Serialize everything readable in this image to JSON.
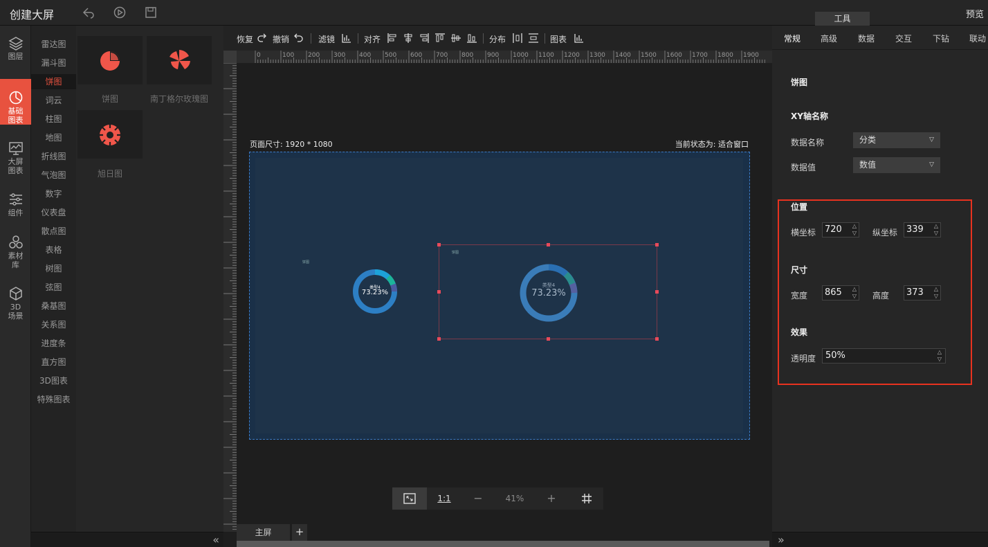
{
  "app": {
    "title": "创建大屏",
    "preview": "预览",
    "tools_tab": "工具"
  },
  "leftnav": [
    {
      "label": "图层",
      "icon": "layers-icon"
    },
    {
      "label": "基础图表",
      "icon": "pie-chart-icon",
      "active": true
    },
    {
      "label": "大屏图表",
      "icon": "screen-chart-icon"
    },
    {
      "label": "组件",
      "icon": "sliders-icon"
    },
    {
      "label": "素材库",
      "icon": "materials-icon"
    },
    {
      "label": "3D场景",
      "icon": "cube-icon"
    }
  ],
  "categories": [
    "雷达图",
    "漏斗图",
    "饼图",
    "词云",
    "柱图",
    "地图",
    "折线图",
    "气泡图",
    "数字",
    "仪表盘",
    "散点图",
    "表格",
    "树图",
    "弦图",
    "桑基图",
    "关系图",
    "进度条",
    "直方图",
    "3D图表",
    "特殊图表"
  ],
  "active_category": "饼图",
  "thumbs": [
    {
      "label": "饼图",
      "icon": "pie-thumb-icon"
    },
    {
      "label": "南丁格尔玫瑰图",
      "icon": "rose-thumb-icon"
    },
    {
      "label": "旭日图",
      "icon": "sunburst-thumb-icon"
    }
  ],
  "toolbar": {
    "redo": "恢复",
    "undo": "撤销",
    "filter": "滤镜",
    "align": "对齐",
    "distribute": "分布",
    "chart": "图表"
  },
  "ruler": {
    "labels": [
      "0",
      "100",
      "200",
      "300",
      "400",
      "500",
      "600",
      "700",
      "800",
      "900",
      "1000",
      "1100",
      "1200",
      "1300",
      "1400",
      "1500",
      "1600",
      "1700",
      "1800",
      "1900"
    ]
  },
  "canvas": {
    "page_size": "页面尺寸: 1920 * 1080",
    "state": "当前状态为: 适合窗口",
    "chart1": {
      "center": "73.23%",
      "sub": "类型4",
      "title": "饼图"
    },
    "chart2": {
      "center": "73.23%",
      "sub": "类型4",
      "title": "饼图"
    }
  },
  "bottombar": {
    "fit": "fit-window-icon",
    "one_to_one": "1:1",
    "minus": "−",
    "zoom": "41%",
    "plus": "+",
    "grid": "grid-icon"
  },
  "tabs": {
    "main": "主屏",
    "add": "+"
  },
  "right": {
    "tabs": [
      "常规",
      "高级",
      "数据",
      "交互",
      "下钻",
      "联动"
    ],
    "active_tab": "常规",
    "chart_name": "饼图",
    "xy_title": "XY轴名称",
    "data_name_label": "数据名称",
    "data_name_value": "分类",
    "data_value_label": "数据值",
    "data_value_value": "数值",
    "position_title": "位置",
    "x_label": "横坐标",
    "x_value": "720",
    "y_label": "纵坐标",
    "y_value": "339",
    "size_title": "尺寸",
    "w_label": "宽度",
    "w_value": "865",
    "h_label": "高度",
    "h_value": "373",
    "effect_title": "效果",
    "opacity_label": "透明度",
    "opacity_value": "50%"
  }
}
